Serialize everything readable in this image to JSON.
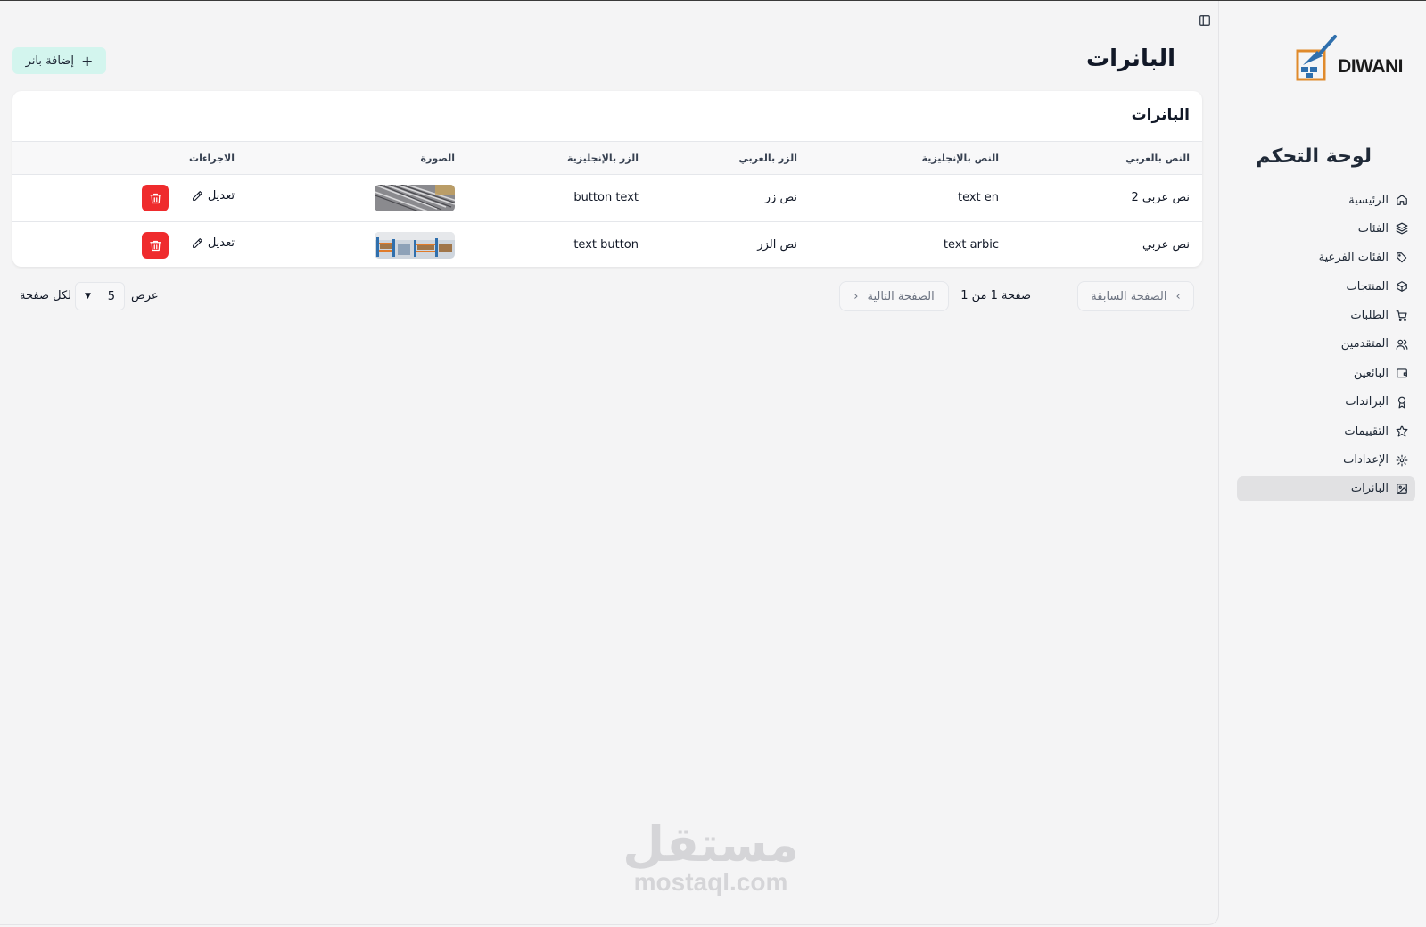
{
  "sidebar": {
    "logo_text": "DIWANI",
    "title": "لوحة التحكم",
    "items": [
      {
        "label": "الرئيسية",
        "icon": "home-icon"
      },
      {
        "label": "الفئات",
        "icon": "layers-icon"
      },
      {
        "label": "الفئات الفرعية",
        "icon": "tag-icon"
      },
      {
        "label": "المنتجات",
        "icon": "package-icon"
      },
      {
        "label": "الطلبات",
        "icon": "cart-icon"
      },
      {
        "label": "المتقدمين",
        "icon": "users-icon"
      },
      {
        "label": "البائعين",
        "icon": "wallet-icon"
      },
      {
        "label": "البراندات",
        "icon": "award-icon"
      },
      {
        "label": "التقييمات",
        "icon": "star-icon"
      },
      {
        "label": "الإعدادات",
        "icon": "settings-icon"
      },
      {
        "label": "البانرات",
        "icon": "image-icon",
        "active": true
      }
    ]
  },
  "header": {
    "page_title": "البانرات",
    "add_button_label": "إضافة بانر"
  },
  "table": {
    "title": "البانرات",
    "columns": [
      "النص بالعربي",
      "النص بالإنجليزية",
      "الزر بالعربي",
      "الزر بالإنجليزية",
      "الصورة",
      "الاجراءات"
    ],
    "rows": [
      {
        "text_ar": "نص عربي 2",
        "text_en": "text en",
        "button_ar": "نص زر",
        "button_en": "button text",
        "image": "steel-rods",
        "edit_label": "تعديل"
      },
      {
        "text_ar": "نص عربي",
        "text_en": "text arbic",
        "button_ar": "نص الزر",
        "button_en": "text button",
        "image": "warehouse",
        "edit_label": "تعديل"
      }
    ]
  },
  "pagination": {
    "prev_label": "الصفحة السابقة",
    "next_label": "الصفحة التالية",
    "page_info": "صفحة 1 من 1",
    "show_label": "عرض",
    "per_page_value": "5",
    "per_page_label": "لكل صفحة"
  },
  "watermark": {
    "ar": "مستقل",
    "en": "mostaql.com"
  },
  "colors": {
    "accent_add": "#d3f5ee",
    "delete": "#ef2b2d",
    "active_nav": "#e1e1e3",
    "logo_orange": "#e08a2c",
    "logo_blue": "#2f6fad"
  }
}
